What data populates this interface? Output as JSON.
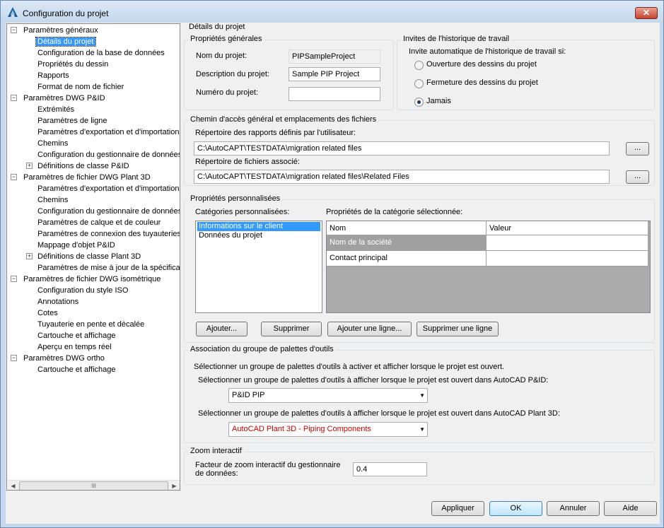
{
  "window": {
    "title": "Configuration du projet",
    "close_glyph": "✕"
  },
  "tree": {
    "nodes": [
      {
        "label": "Paramètres généraux",
        "level": 0,
        "expander": "−"
      },
      {
        "label": "Détails du projet",
        "level": 1,
        "selected": true
      },
      {
        "label": "Configuration de la base de données",
        "level": 1
      },
      {
        "label": "Propriétés du dessin",
        "level": 1
      },
      {
        "label": "Rapports",
        "level": 1
      },
      {
        "label": "Format de nom de fichier",
        "level": 1
      },
      {
        "label": "Paramètres DWG P&ID",
        "level": 0,
        "expander": "−"
      },
      {
        "label": "Extrémités",
        "level": 1
      },
      {
        "label": "Paramètres de ligne",
        "level": 1
      },
      {
        "label": "Paramètres d'exportation et d'importation",
        "level": 1
      },
      {
        "label": "Chemins",
        "level": 1
      },
      {
        "label": "Configuration du gestionnaire de données",
        "level": 1
      },
      {
        "label": "Définitions de classe P&ID",
        "level": 1,
        "expander": "+"
      },
      {
        "label": "Paramètres de fichier DWG Plant 3D",
        "level": 0,
        "expander": "−"
      },
      {
        "label": "Paramètres d'exportation et d'importation",
        "level": 1
      },
      {
        "label": "Chemins",
        "level": 1
      },
      {
        "label": "Configuration du gestionnaire de données",
        "level": 1
      },
      {
        "label": "Paramètres de calque et de couleur",
        "level": 1
      },
      {
        "label": "Paramètres de connexion des tuyauteries",
        "level": 1
      },
      {
        "label": "Mappage d'objet P&ID",
        "level": 1
      },
      {
        "label": "Définitions de classe Plant 3D",
        "level": 1,
        "expander": "+"
      },
      {
        "label": "Paramètres de mise à jour de la spécification",
        "level": 1
      },
      {
        "label": "Paramètres de fichier DWG isométrique",
        "level": 0,
        "expander": "−"
      },
      {
        "label": "Configuration du style ISO",
        "level": 1
      },
      {
        "label": "Annotations",
        "level": 1
      },
      {
        "label": "Cotes",
        "level": 1
      },
      {
        "label": "Tuyauterie en pente et décalée",
        "level": 1
      },
      {
        "label": "Cartouche et affichage",
        "level": 1
      },
      {
        "label": "Aperçu en temps réel",
        "level": 1
      },
      {
        "label": "Paramètres DWG ortho",
        "level": 0,
        "expander": "−"
      },
      {
        "label": "Cartouche et affichage",
        "level": 1
      }
    ],
    "scroll_left": "◀",
    "scroll_right": "▶",
    "scroll_thumb": "III"
  },
  "details": {
    "header": "Détails du projet",
    "general": {
      "title": "Propriétés générales",
      "name_label": "Nom du projet:",
      "name_value": "PIPSampleProject",
      "desc_label": "Description du projet:",
      "desc_value": "Sample PIP Project",
      "number_label": "Numéro du projet:",
      "number_value": ""
    },
    "history": {
      "title": "Invites de l'historique de travail",
      "prompt": "Invite automatique de l'historique de travail si:",
      "options": [
        "Ouverture des dessins du projet",
        "Fermeture des dessins du projet",
        "Jamais"
      ],
      "selected": "Jamais"
    },
    "paths": {
      "title": "Chemin d'accès général et emplacements des fichiers",
      "reports_label": "Répertoire des rapports définis par l'utilisateur:",
      "reports_value": "C:\\AutoCAPT\\TESTDATA\\migration related files",
      "assoc_label": "Répertoire de fichiers associé:",
      "assoc_value": "C:\\AutoCAPT\\TESTDATA\\migration related files\\Related Files",
      "browse_label": "..."
    },
    "custom": {
      "title": "Propriétés personnalisées",
      "categories_label": "Catégories personnalisées:",
      "categories": [
        "Informations sur le client",
        "Données du projet"
      ],
      "selected_category": "Informations sur le client",
      "props_label": "Propriétés de la catégorie sélectionnée:",
      "columns": [
        "Nom",
        "Valeur"
      ],
      "rows": [
        {
          "name": "Nom de la société",
          "value": ""
        },
        {
          "name": "Contact principal",
          "value": ""
        }
      ],
      "buttons": [
        "Ajouter...",
        "Supprimer",
        "Ajouter une ligne...",
        "Supprimer une ligne"
      ]
    },
    "palettes": {
      "title": "Association du groupe de palettes d'outils",
      "intro": "Sélectionner un groupe de palettes d'outils à activer et afficher lorsque le projet est ouvert.",
      "pid_label": "Sélectionner un groupe de palettes d'outils à afficher lorsque le projet est ouvert dans AutoCAD P&ID:",
      "pid_value": "P&ID PIP",
      "plant_label": "Sélectionner un groupe de palettes d'outils à afficher lorsque le projet est ouvert dans AutoCAD Plant 3D:",
      "plant_value": "AutoCAD Plant 3D - Piping Components",
      "plant_value_color": "#cc0000",
      "dropdown_glyph": "▼"
    },
    "zoom": {
      "title": "Zoom interactif",
      "label_line1": "Facteur de zoom interactif du gestionnaire",
      "label_line2": "de données:",
      "value": "0.4"
    }
  },
  "footer": {
    "apply": "Appliquer",
    "ok": "OK",
    "cancel": "Annuler",
    "help": "Aide"
  }
}
